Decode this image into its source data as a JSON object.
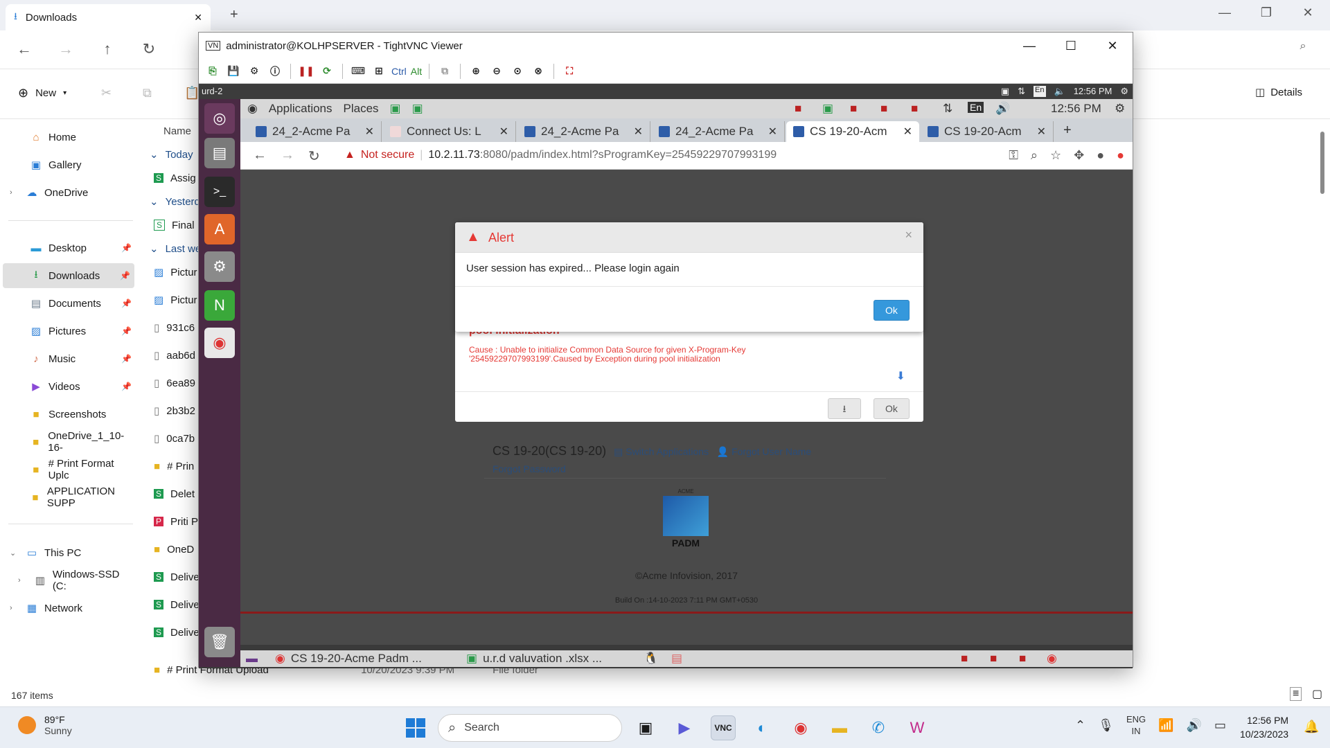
{
  "explorer": {
    "tab_title": "Downloads",
    "new_label": "New",
    "details_label": "Details",
    "column_name": "Name",
    "sidebar": [
      {
        "label": "Home",
        "icon": "home-icon"
      },
      {
        "label": "Gallery",
        "icon": "gallery-icon"
      },
      {
        "label": "OneDrive",
        "icon": "cloud-icon"
      },
      {
        "label": "Desktop",
        "icon": "desktop-icon"
      },
      {
        "label": "Downloads",
        "icon": "download-icon"
      },
      {
        "label": "Documents",
        "icon": "document-icon"
      },
      {
        "label": "Pictures",
        "icon": "picture-icon"
      },
      {
        "label": "Music",
        "icon": "music-icon"
      },
      {
        "label": "Videos",
        "icon": "video-icon"
      },
      {
        "label": "Screenshots",
        "icon": "folder-icon"
      },
      {
        "label": "OneDrive_1_10-16-",
        "icon": "folder-icon"
      },
      {
        "label": "# Print Format Uplc",
        "icon": "folder-icon"
      },
      {
        "label": "APPLICATION SUPP",
        "icon": "folder-icon"
      },
      {
        "label": "This PC",
        "icon": "pc-icon"
      },
      {
        "label": "Windows-SSD (C:",
        "icon": "drive-icon"
      },
      {
        "label": "Network",
        "icon": "network-icon"
      }
    ],
    "groups": {
      "today": "Today",
      "yesterday": "Yesterday",
      "last_week": "Last week"
    },
    "rows": [
      "Assig",
      "Final",
      "Pictur",
      "Pictur",
      "931c6",
      "aab6d",
      "6ea89",
      "2b3b2",
      "0ca7b",
      "# Prin",
      "Delet",
      "Priti P",
      "OneD",
      "Delive",
      "Delive",
      "Delive"
    ],
    "last_row": {
      "name": "# Print Format Upload",
      "date": "10/20/2023 9:39 PM",
      "type": "File folder"
    },
    "status": "167 items"
  },
  "vnc": {
    "title": "administrator@KOLHPSERVER - TightVNC Viewer",
    "toolbar_ctrl": "Ctrl",
    "toolbar_alt": "Alt"
  },
  "remote": {
    "host": "urd-2",
    "outer_lang": "En",
    "outer_time": "12:56 PM",
    "inner_menus": [
      "Applications",
      "Places"
    ],
    "inner_lang": "En",
    "inner_time": "12:56 PM",
    "tabs": [
      {
        "title": "24_2-Acme Pa",
        "active": false
      },
      {
        "title": "Connect Us: L",
        "active": false
      },
      {
        "title": "24_2-Acme Pa",
        "active": false
      },
      {
        "title": "24_2-Acme Pa",
        "active": false
      },
      {
        "title": "CS 19-20-Acm",
        "active": true
      },
      {
        "title": "CS 19-20-Acm",
        "active": false
      }
    ],
    "url_warning": "Not secure",
    "url_host": "10.2.11.73",
    "url_rest": ":8080/padm/index.html?sProgramKey=25459229707993199",
    "alert": {
      "title": "Alert",
      "message": "User session has expired... Please login again",
      "ok": "Ok"
    },
    "error": {
      "title": "pool initialization",
      "cause": "Cause : Unable to initialize Common Data Source for given X-Program-Key '25459229707993199'.Caused by Exception during pool initialization",
      "ok": "Ok"
    },
    "login": {
      "program": "CS 19-20(CS 19-20)",
      "switch": "Switch Applications",
      "forgot_user": "Forgot User Name",
      "forgot_password": "Forgot Password"
    },
    "logo_brand": "ACME",
    "logo_text": "PADM",
    "copyright": "©Acme Infovision, 2017",
    "build": "Build On :14-10-2023 7:11 PM GMT+0530",
    "taskbar": [
      "CS 19-20-Acme Padm ...",
      "u.r.d valuvation .xlsx ..."
    ]
  },
  "taskbar": {
    "weather_temp": "89°F",
    "weather_desc": "Sunny",
    "search": "Search",
    "lang1": "ENG",
    "lang2": "IN",
    "time": "12:56 PM",
    "date": "10/23/2023"
  }
}
